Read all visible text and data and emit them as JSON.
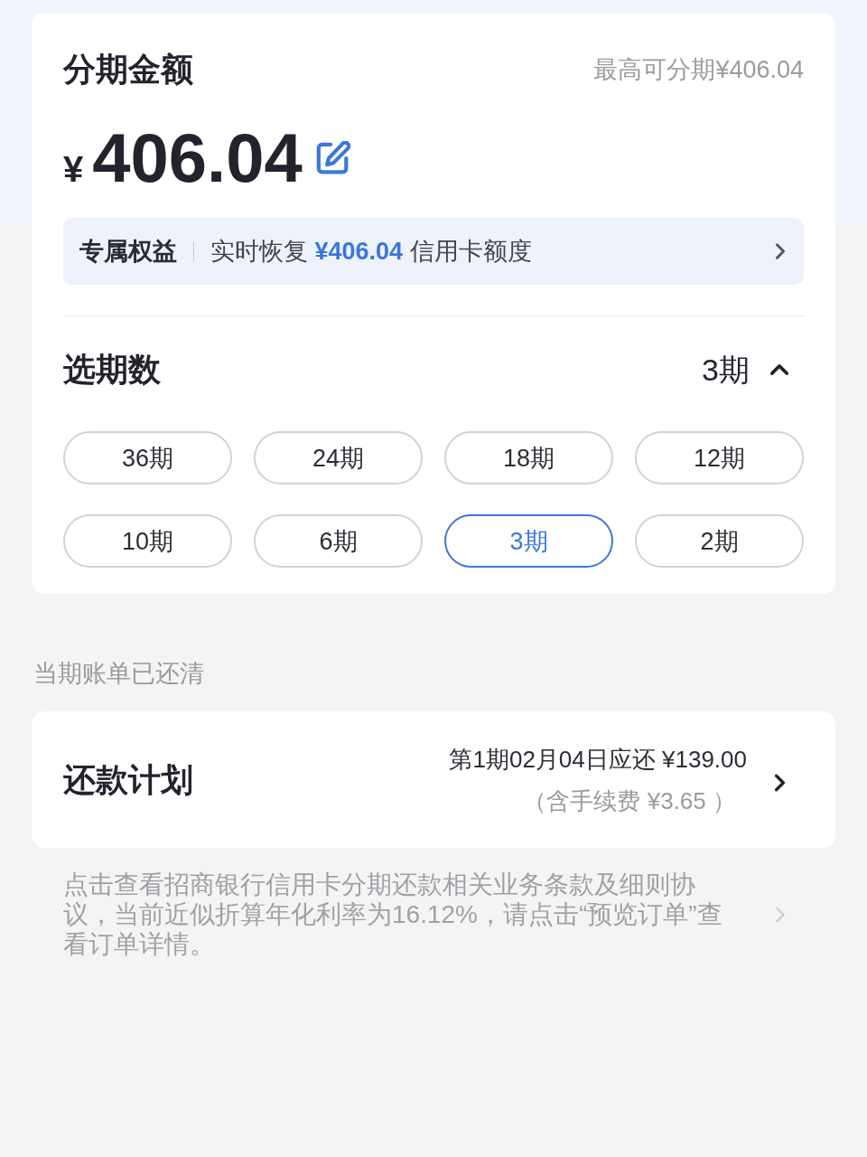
{
  "amount_card": {
    "title": "分期金额",
    "max_label": "最高可分期¥406.04",
    "currency": "¥",
    "amount": "406.04",
    "benefit": {
      "tag": "专属权益",
      "text": "实时恢复 **¥406.04** 信用卡额度"
    }
  },
  "term_picker": {
    "title": "选期数",
    "current": "3期",
    "expanded": true,
    "options": [
      {
        "label": "36期",
        "selected": false
      },
      {
        "label": "24期",
        "selected": false
      },
      {
        "label": "18期",
        "selected": false
      },
      {
        "label": "12期",
        "selected": false
      },
      {
        "label": "10期",
        "selected": false
      },
      {
        "label": "6期",
        "selected": false
      },
      {
        "label": "3期",
        "selected": true
      },
      {
        "label": "2期",
        "selected": false
      }
    ]
  },
  "status_note": "当期账单已还清",
  "repayment_plan": {
    "title": "还款计划",
    "first_payment": "第1期02月04日应还 ¥139.00",
    "fee_note": "（含手续费 ¥3.65 ）"
  },
  "terms_note": "点击查看招商银行信用卡分期还款相关业务条款及细则协议，当前近似折算年化利率为16.12%，请点击“预览订单”查看订单详情。"
}
